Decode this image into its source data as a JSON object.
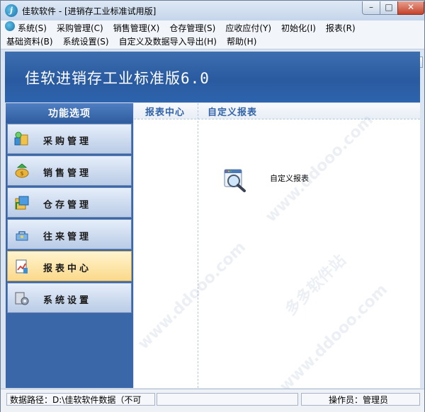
{
  "window": {
    "title": "佳软软件 - [进销存工业标准试用版]",
    "min_glyph": "–",
    "max_glyph": "□",
    "close_glyph": "✕"
  },
  "menu": {
    "row1": [
      "系统(S)",
      "采购管理(C)",
      "销售管理(X)",
      "仓存管理(S)",
      "应收应付(Y)",
      "初始化(I)",
      "报表(R)"
    ],
    "row2": [
      "基础资料(B)",
      "系统设置(S)",
      "自定义及数据导入导出(H)",
      "帮助(H)"
    ],
    "mdi_min": "_",
    "mdi_restore": "▫",
    "mdi_close": "✕"
  },
  "banner": {
    "title_main": "佳软进销存工业标准版",
    "title_version": "6.0"
  },
  "sidebar": {
    "header": "功能选项",
    "items": [
      {
        "label": "采购管理",
        "icon": "purchase-icon"
      },
      {
        "label": "销售管理",
        "icon": "sales-icon"
      },
      {
        "label": "仓存管理",
        "icon": "warehouse-icon"
      },
      {
        "label": "往来管理",
        "icon": "contacts-icon"
      },
      {
        "label": "报表中心",
        "icon": "report-center-icon",
        "active": true
      },
      {
        "label": "系统设置",
        "icon": "system-settings-icon"
      }
    ]
  },
  "content": {
    "tab_left": "报表中心",
    "tab_right": "自定义报表",
    "report_item_label": "自定义报表",
    "report_item_icon": "magnifier-report-icon"
  },
  "status": {
    "data_path": "数据路径：D:\\佳软软件数据（不可",
    "middle": "",
    "operator": "操作员：管理员"
  },
  "colors": {
    "banner_blue": "#2d5fa6",
    "sidebar_blue": "#3a67a8",
    "active_item": "#fbd98a",
    "tab_text": "#3163a8"
  },
  "watermarks": [
    "多多软件站",
    "www.ddooo.com"
  ]
}
